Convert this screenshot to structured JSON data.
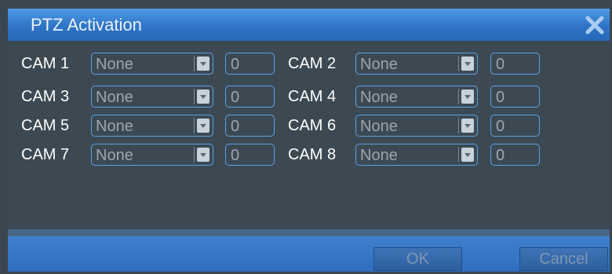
{
  "dialog": {
    "title": "PTZ Activation",
    "close_icon": "close-icon"
  },
  "cameras": [
    {
      "label": "CAM 1",
      "protocol": "None",
      "address": "0"
    },
    {
      "label": "CAM 2",
      "protocol": "None",
      "address": "0"
    },
    {
      "label": "CAM 3",
      "protocol": "None",
      "address": "0"
    },
    {
      "label": "CAM 4",
      "protocol": "None",
      "address": "0"
    },
    {
      "label": "CAM 5",
      "protocol": "None",
      "address": "0"
    },
    {
      "label": "CAM 6",
      "protocol": "None",
      "address": "0"
    },
    {
      "label": "CAM 7",
      "protocol": "None",
      "address": "0"
    },
    {
      "label": "CAM 8",
      "protocol": "None",
      "address": "0"
    }
  ],
  "footer": {
    "ok_label": "OK",
    "cancel_label": "Cancel"
  },
  "colors": {
    "titlebar": "#2f74c7",
    "panel": "#3c4952",
    "field_border": "#5fa0e6",
    "footer": "#3f7fce"
  }
}
